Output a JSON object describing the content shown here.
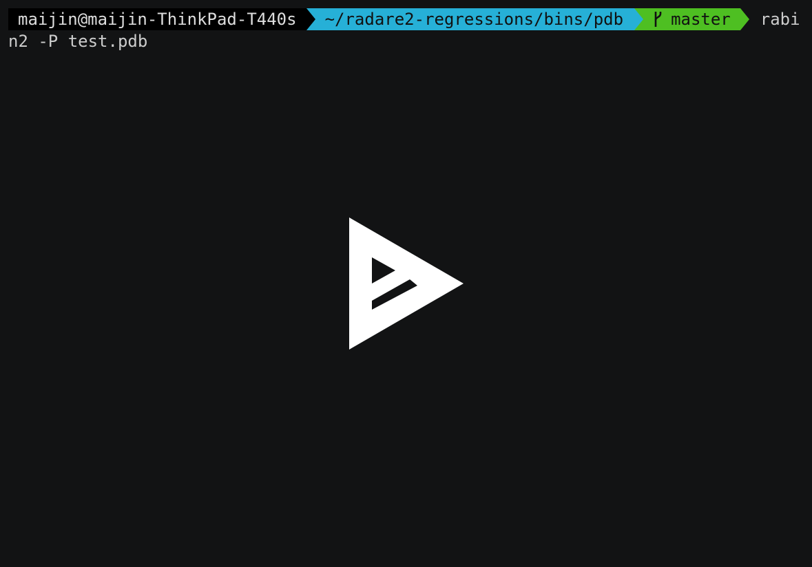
{
  "prompt": {
    "user_host": "maijin@maijin-ThinkPad-T440s",
    "path": "~/radare2-regressions/bins/pdb",
    "branch": "master",
    "command_part1": "rabi",
    "command_part2": "n2 -P test.pdb"
  },
  "colors": {
    "background": "#121314",
    "user_segment": "#000000",
    "path_segment": "#26b0d7",
    "git_segment": "#4ebf22",
    "text": "#cccccc"
  },
  "icons": {
    "branch": "git-branch-icon",
    "play": "play-button-icon"
  }
}
